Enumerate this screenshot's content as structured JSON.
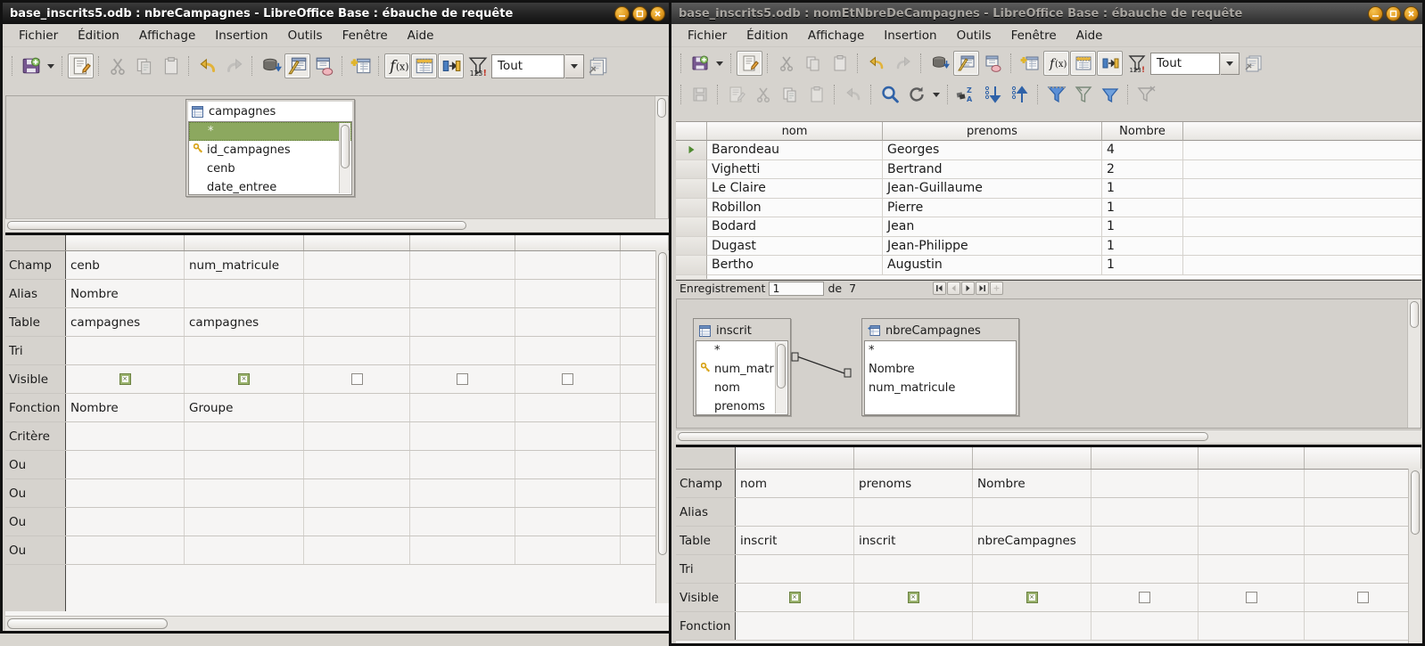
{
  "left_window": {
    "title": "base_inscrits5.odb : nbreCampagnes - LibreOffice Base : ébauche de requête",
    "window_buttons": [
      {
        "name": "minimize-button",
        "glyph": "_"
      },
      {
        "name": "maximize-button",
        "glyph": "□"
      },
      {
        "name": "close-button",
        "glyph": "✕"
      }
    ],
    "menu": [
      "Fichier",
      "Édition",
      "Affichage",
      "Insertion",
      "Outils",
      "Fenêtre",
      "Aide"
    ],
    "toolbar": {
      "combo_value": "Tout",
      "icons": [
        "save-icon",
        "save-dropdown-icon",
        "edit-icon",
        "cut-icon",
        "copy-icon",
        "paste-icon",
        "undo-icon",
        "redo-icon",
        "run-query-icon",
        "design-view-icon",
        "clear-query-icon",
        "add-table-icon",
        "functions-icon",
        "table-names-icon",
        "aliases-icon",
        "distinct-values-icon",
        "limit-combo",
        "sql-view-icon"
      ]
    },
    "diagram": {
      "tables": [
        {
          "name": "campagnes",
          "icon": "table-icon",
          "fields": [
            {
              "label": "*",
              "selected": true,
              "key": false
            },
            {
              "label": "id_campagnes",
              "selected": false,
              "key": true
            },
            {
              "label": "cenb",
              "selected": false,
              "key": false
            },
            {
              "label": "date_entree",
              "selected": false,
              "key": false
            }
          ]
        }
      ]
    },
    "query_grid": {
      "row_labels": [
        "",
        "Champ",
        "Alias",
        "Table",
        "Tri",
        "Visible",
        "Fonction",
        "Critère",
        "Ou",
        "Ou",
        "Ou",
        "Ou",
        ""
      ],
      "columns": [
        {
          "champ": "cenb",
          "alias": "Nombre",
          "table": "campagnes",
          "tri": "",
          "visible": true,
          "fonction": "Nombre",
          "critere": ""
        },
        {
          "champ": "num_matricule",
          "alias": "",
          "table": "campagnes",
          "tri": "",
          "visible": true,
          "fonction": "Groupe",
          "critere": ""
        },
        {
          "champ": "",
          "alias": "",
          "table": "",
          "tri": "",
          "visible": false,
          "fonction": "",
          "critere": ""
        },
        {
          "champ": "",
          "alias": "",
          "table": "",
          "tri": "",
          "visible": false,
          "fonction": "",
          "critere": ""
        },
        {
          "champ": "",
          "alias": "",
          "table": "",
          "tri": "",
          "visible": false,
          "fonction": "",
          "critere": ""
        },
        {
          "champ": "",
          "alias": "",
          "table": "",
          "tri": "",
          "visible": false,
          "fonction": "",
          "critere": ""
        }
      ]
    }
  },
  "right_window": {
    "title": "base_inscrits5.odb : nomEtNbreDeCampagnes - LibreOffice Base : ébauche de requête",
    "window_buttons": [
      {
        "name": "minimize-button",
        "glyph": "_"
      },
      {
        "name": "maximize-button",
        "glyph": "□"
      },
      {
        "name": "close-button",
        "glyph": "✕"
      }
    ],
    "menu": [
      "Fichier",
      "Édition",
      "Affichage",
      "Insertion",
      "Outils",
      "Fenêtre",
      "Aide"
    ],
    "toolbar": {
      "combo_value": "Tout",
      "icons": [
        "save-icon",
        "save-dropdown-icon",
        "edit-icon",
        "cut-icon",
        "copy-icon",
        "paste-icon",
        "undo-icon",
        "redo-icon",
        "run-query-icon",
        "design-view-icon",
        "clear-query-icon",
        "add-table-icon",
        "functions-icon",
        "table-names-icon",
        "aliases-icon",
        "distinct-values-icon",
        "limit-combo",
        "sql-view-icon"
      ]
    },
    "toolbar2": {
      "icons": [
        "save-record-icon",
        "edit-data-icon",
        "cut-icon",
        "copy-icon",
        "paste-icon",
        "undo-icon",
        "find-record-icon",
        "refresh-icon",
        "refresh-dropdown-icon",
        "sort-icon",
        "sort-descending-icon",
        "sort-ascending-icon",
        "autofilter-icon",
        "apply-filter-icon",
        "standard-filter-icon",
        "remove-filter-icon"
      ]
    },
    "results": {
      "columns": [
        "",
        "nom",
        "prenoms",
        "Nombre",
        ""
      ],
      "rows": [
        {
          "marker": "current",
          "nom": "Barondeau",
          "prenoms": "Georges",
          "nombre": "4"
        },
        {
          "marker": "",
          "nom": "Vighetti",
          "prenoms": "Bertrand",
          "nombre": "2"
        },
        {
          "marker": "",
          "nom": "Le Claire",
          "prenoms": "Jean-Guillaume",
          "nombre": "1"
        },
        {
          "marker": "",
          "nom": "Robillon",
          "prenoms": "Pierre",
          "nombre": "1"
        },
        {
          "marker": "",
          "nom": "Bodard",
          "prenoms": "Jean",
          "nombre": "1"
        },
        {
          "marker": "",
          "nom": "Dugast",
          "prenoms": "Jean-Philippe",
          "nombre": "1"
        },
        {
          "marker": "",
          "nom": "Bertho",
          "prenoms": "Augustin",
          "nombre": "1"
        }
      ]
    },
    "navbar": {
      "label": "Enregistrement",
      "current": "1",
      "of_label": "de",
      "total": "7",
      "buttons": [
        "first-record-button",
        "previous-record-button",
        "next-record-button",
        "last-record-button",
        "new-record-button"
      ]
    },
    "diagram": {
      "tables": [
        {
          "name": "inscrit",
          "icon": "table-icon",
          "fields": [
            {
              "label": "*",
              "selected": false,
              "key": false
            },
            {
              "label": "num_matri",
              "selected": false,
              "key": true
            },
            {
              "label": "nom",
              "selected": false,
              "key": false
            },
            {
              "label": "prenoms",
              "selected": false,
              "key": false
            }
          ]
        },
        {
          "name": "nbreCampagnes",
          "icon": "query-icon",
          "fields": [
            {
              "label": "*",
              "selected": false,
              "key": false
            },
            {
              "label": "Nombre",
              "selected": false,
              "key": false
            },
            {
              "label": "num_matricule",
              "selected": false,
              "key": false
            }
          ]
        }
      ],
      "join": "inscrit.num_matricule = nbreCampagnes.num_matricule"
    },
    "query_grid": {
      "row_labels": [
        "",
        "Champ",
        "Alias",
        "Table",
        "Tri",
        "Visible",
        "Fonction"
      ],
      "columns": [
        {
          "champ": "nom",
          "alias": "",
          "table": "inscrit",
          "tri": "",
          "visible": true,
          "fonction": ""
        },
        {
          "champ": "prenoms",
          "alias": "",
          "table": "inscrit",
          "tri": "",
          "visible": true,
          "fonction": ""
        },
        {
          "champ": "Nombre",
          "alias": "",
          "table": "nbreCampagnes",
          "tri": "",
          "visible": true,
          "fonction": ""
        },
        {
          "champ": "",
          "alias": "",
          "table": "",
          "tri": "",
          "visible": false,
          "fonction": ""
        },
        {
          "champ": "",
          "alias": "",
          "table": "",
          "tri": "",
          "visible": false,
          "fonction": ""
        },
        {
          "champ": "",
          "alias": "",
          "table": "",
          "tri": "",
          "visible": false,
          "fonction": ""
        }
      ]
    }
  },
  "colors": {
    "selection_green": "#8ca85f",
    "titlebar_active": "#111111",
    "titlebar_inactive": "#474747",
    "window_button": "#e0991f",
    "face": "#d6d3ce"
  }
}
